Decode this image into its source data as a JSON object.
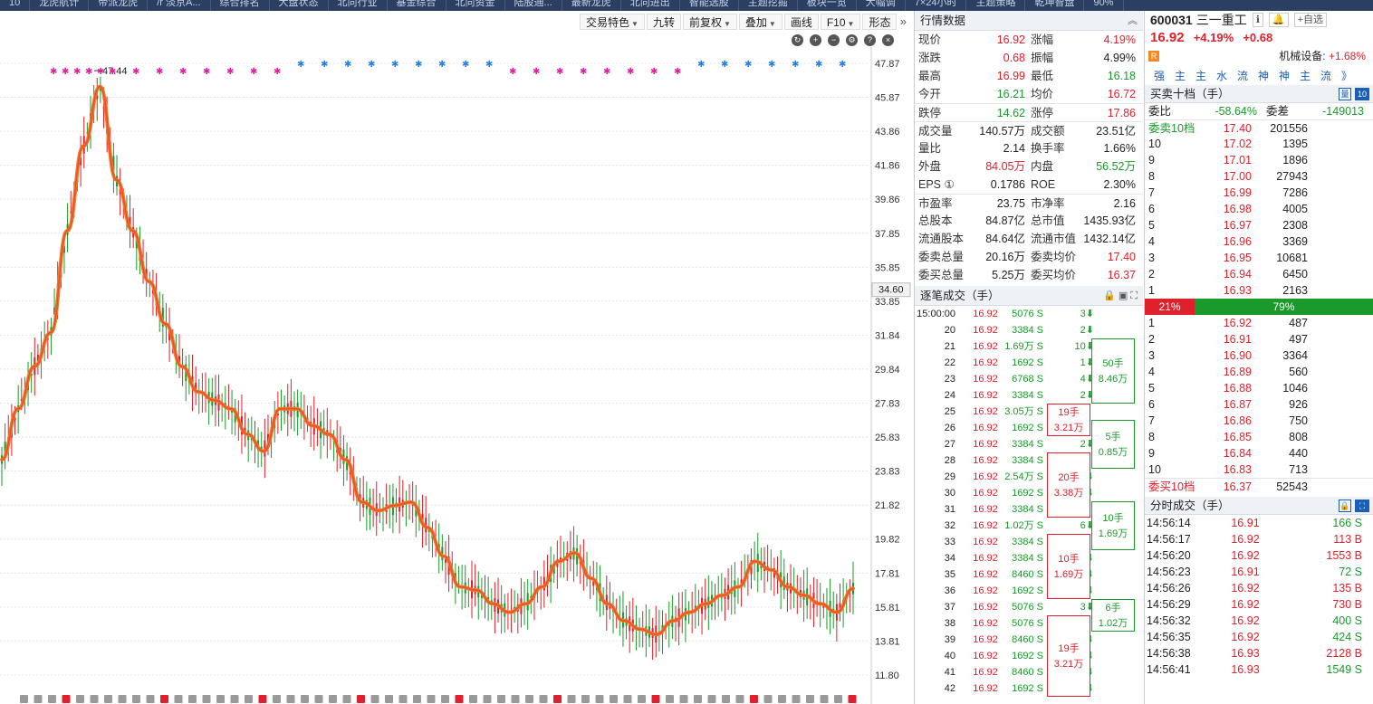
{
  "topnav": [
    "10",
    "龙虎航计",
    "帝派龙虎",
    "/r 淡京A...",
    "综合排名",
    "大盘状态",
    "北向行业",
    "基金综合",
    "北向资金",
    "陆股通...",
    "最新龙虎",
    "北向进出",
    "智能选股",
    "主题挖掘",
    "板块一览",
    "大幅调",
    "7×24小时",
    "主题策略",
    "乾坤智盘",
    "90%"
  ],
  "chart_toolbar": [
    "交易特色",
    "九转",
    "前复权",
    "叠加",
    "画线",
    "F10",
    "形态"
  ],
  "chart_icons": [
    "↻",
    "+",
    "−",
    "⚙",
    "?",
    "×"
  ],
  "chart_data": {
    "type": "line",
    "title": "",
    "y_ticks": [
      47.87,
      45.87,
      43.86,
      41.86,
      39.86,
      37.85,
      35.85,
      33.85,
      31.84,
      29.84,
      27.83,
      25.83,
      23.83,
      21.82,
      19.82,
      17.81,
      15.81,
      13.81,
      11.8
    ],
    "ylim": [
      11.8,
      47.87
    ],
    "current_price_label": "34.60",
    "max_label": "47.44",
    "grid": true,
    "series": [
      {
        "values": [
          24.5,
          27.5,
          30.0,
          32.0,
          38.0,
          43.0,
          46.5,
          41.0,
          38.0,
          35.0,
          32.5,
          30.0,
          28.5,
          28.0,
          27.5,
          26.0,
          25.0,
          27.5,
          27.5,
          26.5,
          26.0,
          24.5,
          22.0,
          21.5,
          21.8,
          22.0,
          20.5,
          18.8,
          17.0,
          16.8,
          16.0,
          15.5,
          16.0,
          17.0,
          18.5,
          19.0,
          17.5,
          16.0,
          15.0,
          14.5,
          14.2,
          15.0,
          15.5,
          16.0,
          16.5,
          17.0,
          18.5,
          18.0,
          17.0,
          16.5,
          16.0,
          15.5,
          16.9
        ]
      }
    ]
  },
  "quote": {
    "header": "行情数据",
    "rows": [
      {
        "k": "现价",
        "v": "16.92",
        "vc": "red",
        "k2": "涨幅",
        "v2": "4.19%",
        "v2c": "red"
      },
      {
        "k": "涨跌",
        "v": "0.68",
        "vc": "red",
        "k2": "振幅",
        "v2": "4.99%",
        "v2c": "dark"
      },
      {
        "k": "最高",
        "v": "16.99",
        "vc": "red",
        "k2": "最低",
        "v2": "16.18",
        "v2c": "green"
      },
      {
        "k": "今开",
        "v": "16.21",
        "vc": "green",
        "k2": "均价",
        "v2": "16.72",
        "v2c": "red"
      },
      {
        "k": "跌停",
        "v": "14.62",
        "vc": "green",
        "k2": "涨停",
        "v2": "17.86",
        "v2c": "red"
      },
      {
        "k": "成交量",
        "v": "140.57万",
        "vc": "dark",
        "k2": "成交额",
        "v2": "23.51亿",
        "v2c": "dark"
      },
      {
        "k": "量比",
        "v": "2.14",
        "vc": "dark",
        "k2": "换手率",
        "v2": "1.66%",
        "v2c": "dark"
      },
      {
        "k": "外盘",
        "v": "84.05万",
        "vc": "red",
        "k2": "内盘",
        "v2": "56.52万",
        "v2c": "green"
      },
      {
        "k": "EPS ①",
        "v": "0.1786",
        "vc": "dark",
        "k2": "ROE",
        "v2": "2.30%",
        "v2c": "dark"
      },
      {
        "k": "市盈率",
        "v": "23.75",
        "vc": "dark",
        "k2": "市净率",
        "v2": "2.16",
        "v2c": "dark"
      },
      {
        "k": "总股本",
        "v": "84.87亿",
        "vc": "dark",
        "k2": "总市值",
        "v2": "1435.93亿",
        "v2c": "dark"
      },
      {
        "k": "流通股本",
        "v": "84.64亿",
        "vc": "dark",
        "k2": "流通市值",
        "v2": "1432.14亿",
        "v2c": "dark"
      },
      {
        "k": "委卖总量",
        "v": "20.16万",
        "vc": "dark",
        "k2": "委卖均价",
        "v2": "17.40",
        "v2c": "red"
      },
      {
        "k": "委买总量",
        "v": "5.25万",
        "vc": "dark",
        "k2": "委买均价",
        "v2": "16.37",
        "v2c": "red"
      }
    ],
    "ticks_header": "逐笔成交（手）",
    "ticks": [
      {
        "t": "15:00:00",
        "p": "16.92",
        "v": "5076 S",
        "n": "3⬇",
        "c": "g"
      },
      {
        "t": "20",
        "p": "16.92",
        "v": "3384 S",
        "n": "2⬇",
        "c": "g"
      },
      {
        "t": "21",
        "p": "16.92",
        "v": "1.69万 S",
        "n": "10⬇",
        "c": "g"
      },
      {
        "t": "22",
        "p": "16.92",
        "v": "1692 S",
        "n": "1⬇",
        "c": "g"
      },
      {
        "t": "23",
        "p": "16.92",
        "v": "6768 S",
        "n": "4⬇",
        "c": "g"
      },
      {
        "t": "24",
        "p": "16.92",
        "v": "3384 S",
        "n": "2⬇",
        "c": "g"
      },
      {
        "t": "25",
        "p": "16.92",
        "v": "3.05万 S",
        "n": "",
        "c": "g"
      },
      {
        "t": "26",
        "p": "16.92",
        "v": "1692 S",
        "n": "",
        "c": "g"
      },
      {
        "t": "27",
        "p": "16.92",
        "v": "3384 S",
        "n": "2⬇",
        "c": "g"
      },
      {
        "t": "28",
        "p": "16.92",
        "v": "3384 S",
        "n": "",
        "c": "g"
      },
      {
        "t": "29",
        "p": "16.92",
        "v": "2.54万 S",
        "n": "15⬇",
        "c": "g"
      },
      {
        "t": "30",
        "p": "16.92",
        "v": "1692 S",
        "n": "1⬇",
        "c": "g"
      },
      {
        "t": "31",
        "p": "16.92",
        "v": "3384 S",
        "n": "",
        "c": "g"
      },
      {
        "t": "32",
        "p": "16.92",
        "v": "1.02万 S",
        "n": "6⬇",
        "c": "g"
      },
      {
        "t": "33",
        "p": "16.92",
        "v": "3384 S",
        "n": "",
        "c": "g"
      },
      {
        "t": "34",
        "p": "16.92",
        "v": "3384 S",
        "n": "2⬇",
        "c": "g"
      },
      {
        "t": "35",
        "p": "16.92",
        "v": "8460 S",
        "n": "5⬇",
        "c": "g"
      },
      {
        "t": "36",
        "p": "16.92",
        "v": "1692 S",
        "n": "1⬇",
        "c": "g"
      },
      {
        "t": "37",
        "p": "16.92",
        "v": "5076 S",
        "n": "3⬇",
        "c": "g"
      },
      {
        "t": "38",
        "p": "16.92",
        "v": "5076 S",
        "n": "",
        "c": "g"
      },
      {
        "t": "39",
        "p": "16.92",
        "v": "8460 S",
        "n": "5⬇",
        "c": "g"
      },
      {
        "t": "40",
        "p": "16.92",
        "v": "1692 S",
        "n": "1⬇",
        "c": "g"
      },
      {
        "t": "41",
        "p": "16.92",
        "v": "8460 S",
        "n": "5⬇",
        "c": "g"
      },
      {
        "t": "42",
        "p": "16.92",
        "v": "1692 S",
        "n": "1⬇",
        "c": "g"
      }
    ],
    "tick_boxes": [
      {
        "l1": "50手",
        "l2": "8.46万",
        "c": "g",
        "r0": 2,
        "r1": 6
      },
      {
        "l1": "19手",
        "l2": "3.21万",
        "c": "r",
        "r0": 6,
        "r1": 8
      },
      {
        "l1": "5手",
        "l2": "0.85万",
        "c": "g",
        "r0": 7,
        "r1": 10
      },
      {
        "l1": "20手",
        "l2": "3.38万",
        "c": "r",
        "r0": 9,
        "r1": 13
      },
      {
        "l1": "10手",
        "l2": "1.69万",
        "c": "g",
        "r0": 12,
        "r1": 15
      },
      {
        "l1": "10手",
        "l2": "1.69万",
        "c": "r",
        "r0": 14,
        "r1": 18
      },
      {
        "l1": "6手",
        "l2": "1.02万",
        "c": "g",
        "r0": 18,
        "r1": 20
      },
      {
        "l1": "19手",
        "l2": "3.21万",
        "c": "r",
        "r0": 19,
        "r1": 24
      }
    ]
  },
  "stock": {
    "code": "600031",
    "name": "三一重工",
    "info_btn": "ℹ",
    "alert_btn": "🔔",
    "add_btn": "+自选",
    "price": "16.92",
    "pct": "+4.19%",
    "chg": "+0.68",
    "badge": "R",
    "industry": "机械设备:",
    "industry_pct": "+1.68%",
    "tags": [
      "强",
      "主",
      "主",
      "水",
      "流",
      "神",
      "神",
      "主",
      "流",
      "》"
    ]
  },
  "orderbook": {
    "header": "买卖十档（手）",
    "weibi_k": "委比",
    "weibi_v": "-58.64%",
    "weicha_k": "委差",
    "weicha_v": "-149013",
    "sell10_k": "委卖10档",
    "sell10_p": "17.40",
    "sell10_v": "201556",
    "asks": [
      {
        "l": "10",
        "p": "17.02",
        "v": "1395"
      },
      {
        "l": "9",
        "p": "17.01",
        "v": "1896"
      },
      {
        "l": "8",
        "p": "17.00",
        "v": "27943"
      },
      {
        "l": "7",
        "p": "16.99",
        "v": "7286"
      },
      {
        "l": "6",
        "p": "16.98",
        "v": "4005"
      },
      {
        "l": "5",
        "p": "16.97",
        "v": "2308"
      },
      {
        "l": "4",
        "p": "16.96",
        "v": "3369"
      },
      {
        "l": "3",
        "p": "16.95",
        "v": "10681"
      },
      {
        "l": "2",
        "p": "16.94",
        "v": "6450"
      },
      {
        "l": "1",
        "p": "16.93",
        "v": "2163"
      }
    ],
    "ratio_red": "21%",
    "ratio_green": "79%",
    "bids": [
      {
        "l": "1",
        "p": "16.92",
        "v": "487"
      },
      {
        "l": "2",
        "p": "16.91",
        "v": "497"
      },
      {
        "l": "3",
        "p": "16.90",
        "v": "3364"
      },
      {
        "l": "4",
        "p": "16.89",
        "v": "560"
      },
      {
        "l": "5",
        "p": "16.88",
        "v": "1046"
      },
      {
        "l": "6",
        "p": "16.87",
        "v": "926"
      },
      {
        "l": "7",
        "p": "16.86",
        "v": "750"
      },
      {
        "l": "8",
        "p": "16.85",
        "v": "808"
      },
      {
        "l": "9",
        "p": "16.84",
        "v": "440"
      },
      {
        "l": "10",
        "p": "16.83",
        "v": "713"
      }
    ],
    "buy10_k": "委买10档",
    "buy10_p": "16.37",
    "buy10_v": "52543"
  },
  "fenshi": {
    "header": "分时成交（手）",
    "rows": [
      {
        "t": "14:56:14",
        "p": "16.91",
        "v": "166 S",
        "c": "g"
      },
      {
        "t": "14:56:17",
        "p": "16.92",
        "v": "113 B",
        "c": "r"
      },
      {
        "t": "14:56:20",
        "p": "16.92",
        "v": "1553 B",
        "c": "r"
      },
      {
        "t": "14:56:23",
        "p": "16.91",
        "v": "72 S",
        "c": "g"
      },
      {
        "t": "14:56:26",
        "p": "16.92",
        "v": "135 B",
        "c": "r"
      },
      {
        "t": "14:56:29",
        "p": "16.92",
        "v": "730 B",
        "c": "r"
      },
      {
        "t": "14:56:32",
        "p": "16.92",
        "v": "400 S",
        "c": "g"
      },
      {
        "t": "14:56:35",
        "p": "16.92",
        "v": "424 S",
        "c": "g"
      },
      {
        "t": "14:56:38",
        "p": "16.93",
        "v": "2128 B",
        "c": "r"
      },
      {
        "t": "14:56:41",
        "p": "16.93",
        "v": "1549 S",
        "c": "g"
      }
    ]
  },
  "colors": {
    "up": "#e0202a",
    "down": "#1a9a2a",
    "accent": "#1a5fb4",
    "ma_orange": "#f07a28"
  }
}
